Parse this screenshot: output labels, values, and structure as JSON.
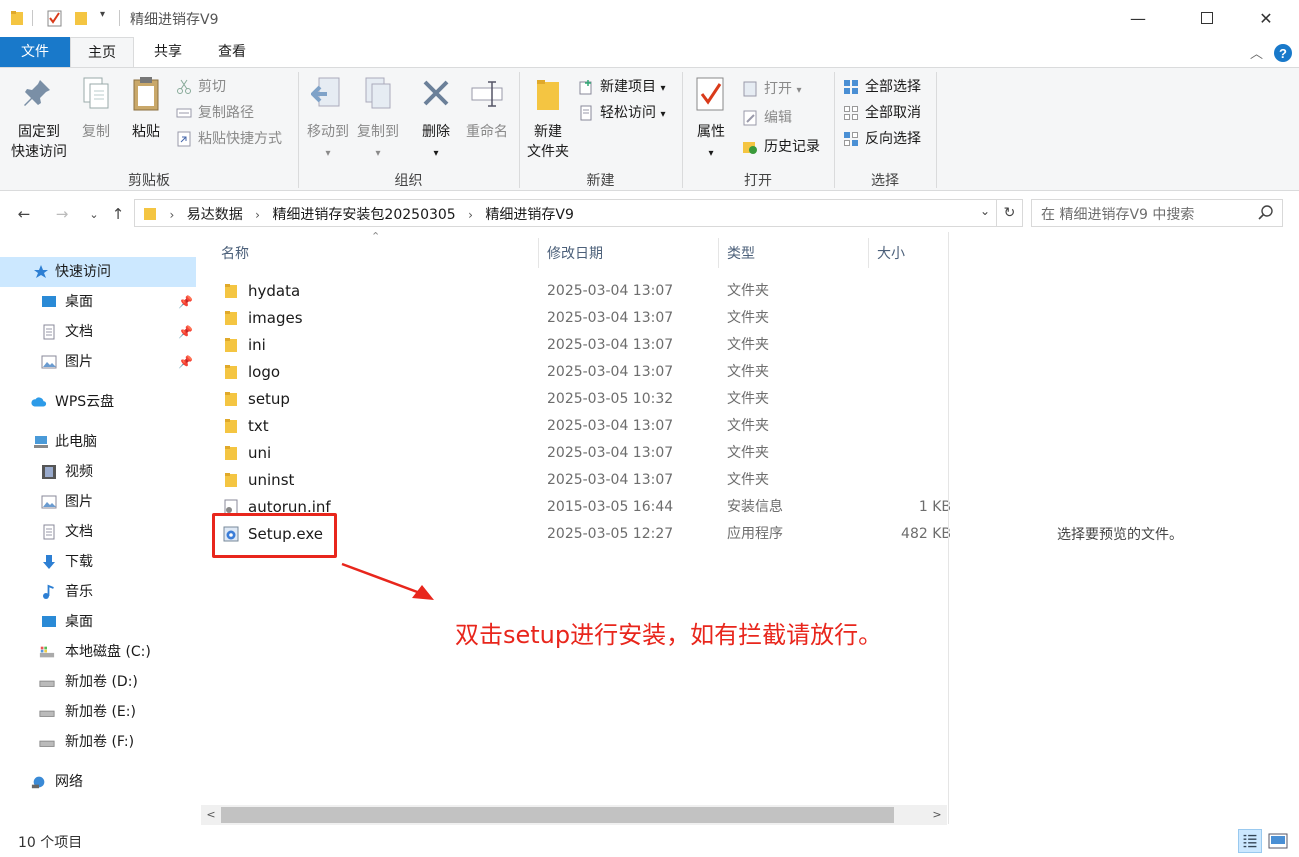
{
  "window": {
    "title": "精细进销存V9",
    "controls": [
      "minimize",
      "maximize",
      "close"
    ]
  },
  "ribbon_tabs": [
    {
      "label": "文件",
      "active": false
    },
    {
      "label": "主页",
      "active": true
    },
    {
      "label": "共享",
      "active": false
    },
    {
      "label": "查看",
      "active": false
    }
  ],
  "ribbon": {
    "clipboard": {
      "group_label": "剪贴板",
      "pin_label_1": "固定到",
      "pin_label_2": "快速访问",
      "copy_label": "复制",
      "paste_label": "粘贴",
      "cut_label": "剪切",
      "copy_path_label": "复制路径",
      "paste_shortcut_label": "粘贴快捷方式"
    },
    "organize": {
      "group_label": "组织",
      "move_to_label": "移动到",
      "copy_to_label": "复制到",
      "delete_label": "删除",
      "rename_label": "重命名"
    },
    "new": {
      "group_label": "新建",
      "new_folder_label_1": "新建",
      "new_folder_label_2": "文件夹",
      "new_item_label": "新建项目",
      "easy_access_label": "轻松访问"
    },
    "open": {
      "group_label": "打开",
      "properties_label": "属性",
      "open_label": "打开",
      "edit_label": "编辑",
      "history_label": "历史记录"
    },
    "select": {
      "group_label": "选择",
      "select_all_label": "全部选择",
      "select_none_label": "全部取消",
      "invert_label": "反向选择"
    }
  },
  "address_bar": {
    "breadcrumbs": [
      "易达数据",
      "精细进销存安装包20250305",
      "精细进销存V9"
    ],
    "search_placeholder": "在 精细进销存V9 中搜索"
  },
  "nav_pane": {
    "quick_access": "快速访问",
    "pinned": [
      "桌面",
      "文档",
      "图片"
    ],
    "wps": "WPS云盘",
    "this_pc": "此电脑",
    "pc_items": [
      "视频",
      "图片",
      "文档",
      "下载",
      "音乐",
      "桌面",
      "本地磁盘 (C:)",
      "新加卷 (D:)",
      "新加卷 (E:)",
      "新加卷 (F:)"
    ],
    "network": "网络"
  },
  "columns": {
    "name": "名称",
    "modified": "修改日期",
    "type": "类型",
    "size": "大小"
  },
  "files": [
    {
      "name": "hydata",
      "modified": "2025-03-04 13:07",
      "type": "文件夹",
      "size": "",
      "icon": "folder-icon"
    },
    {
      "name": "images",
      "modified": "2025-03-04 13:07",
      "type": "文件夹",
      "size": "",
      "icon": "folder-icon"
    },
    {
      "name": "ini",
      "modified": "2025-03-04 13:07",
      "type": "文件夹",
      "size": "",
      "icon": "folder-icon"
    },
    {
      "name": "logo",
      "modified": "2025-03-04 13:07",
      "type": "文件夹",
      "size": "",
      "icon": "folder-icon"
    },
    {
      "name": "setup",
      "modified": "2025-03-05 10:32",
      "type": "文件夹",
      "size": "",
      "icon": "folder-icon"
    },
    {
      "name": "txt",
      "modified": "2025-03-04 13:07",
      "type": "文件夹",
      "size": "",
      "icon": "folder-icon"
    },
    {
      "name": "uni",
      "modified": "2025-03-04 13:07",
      "type": "文件夹",
      "size": "",
      "icon": "folder-icon"
    },
    {
      "name": "uninst",
      "modified": "2025-03-04 13:07",
      "type": "文件夹",
      "size": "",
      "icon": "folder-icon"
    },
    {
      "name": "autorun.inf",
      "modified": "2015-03-05 16:44",
      "type": "安装信息",
      "size": "1 KB",
      "icon": "settings-file-icon"
    },
    {
      "name": "Setup.exe",
      "modified": "2025-03-05 12:27",
      "type": "应用程序",
      "size": "482 KB",
      "icon": "installer-icon"
    }
  ],
  "preview_message": "选择要预览的文件。",
  "status": {
    "item_count": "10 个项目"
  },
  "annotation": {
    "text": "双击setup进行安装，如有拦截请放行。",
    "color": "#e8261c"
  },
  "colors": {
    "accent": "#1979ca",
    "selection": "#cce8ff",
    "folder": "#f4c542"
  }
}
